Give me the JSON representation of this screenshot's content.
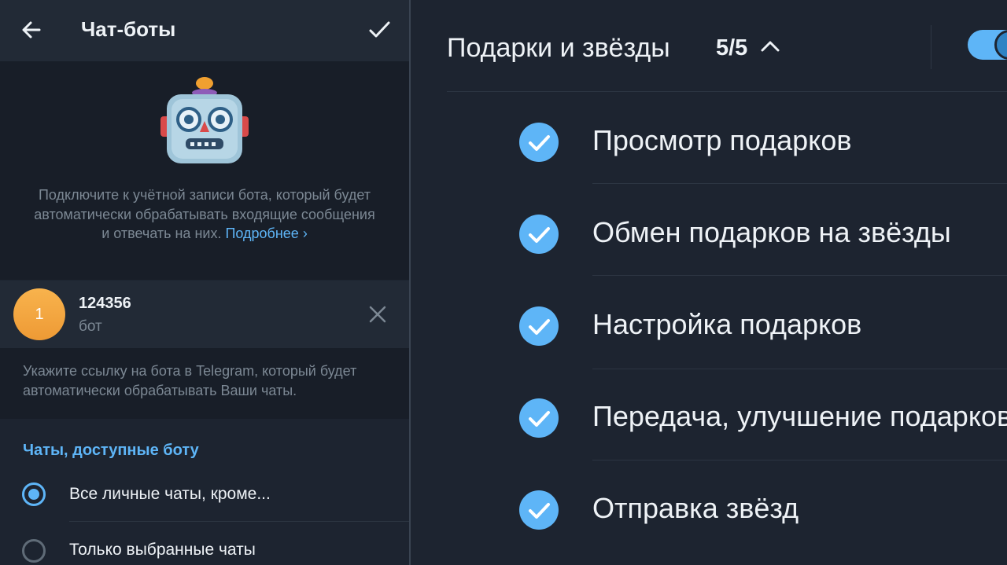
{
  "left": {
    "title": "Чат-боты",
    "description": "Подключите к учётной записи бота, который будет автоматически обрабатывать входящие сообщения и отвечать на них.",
    "description_link": "Подробнее ›",
    "bot": {
      "avatar_letter": "1",
      "name": "124356",
      "subtitle": "бот"
    },
    "hint": "Укажите ссылку на бота в Telegram, который будет автоматически обрабатывать Ваши чаты.",
    "section_title": "Чаты, доступные боту",
    "options": [
      {
        "label": "Все личные чаты, кроме...",
        "selected": true
      },
      {
        "label": "Только выбранные чаты",
        "selected": false
      }
    ]
  },
  "right": {
    "section_title": "Подарки и звёзды",
    "count": "5/5",
    "toggle_on": true,
    "permissions": [
      {
        "label": "Просмотр подарков",
        "checked": true
      },
      {
        "label": "Обмен подарков на звёзды",
        "checked": true
      },
      {
        "label": "Настройка подарков",
        "checked": true
      },
      {
        "label": "Передача, улучшение подарков",
        "checked": true
      },
      {
        "label": "Отправка звёзд",
        "checked": true
      }
    ]
  },
  "colors": {
    "accent": "#5eb5f7",
    "background": "#1d2430",
    "surface": "#222a36",
    "text": "#eef2f6",
    "muted": "#7c8894",
    "avatar": "#f5a94a"
  }
}
